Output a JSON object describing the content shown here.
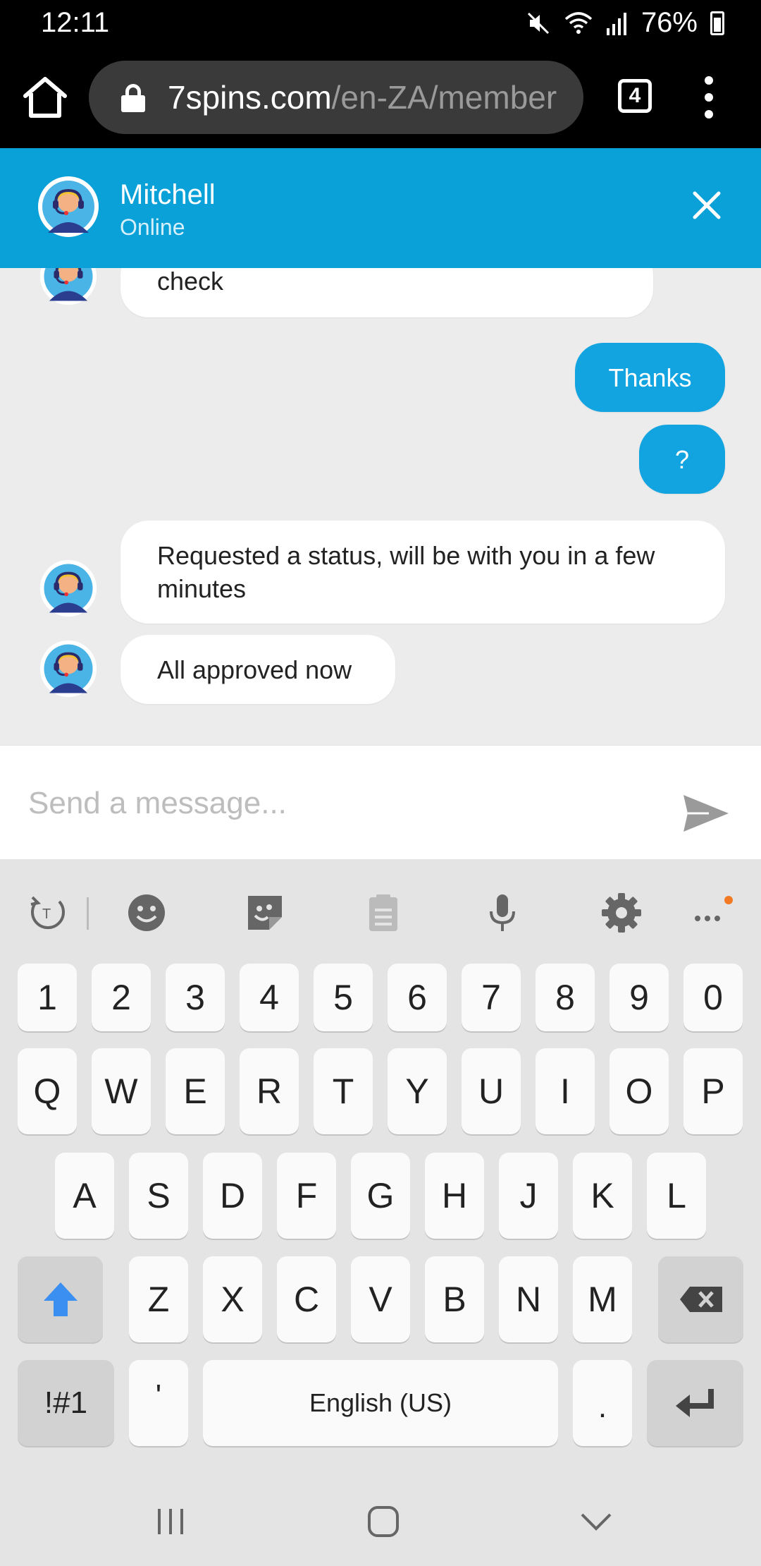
{
  "status_bar": {
    "time": "12:11",
    "battery": "76%"
  },
  "browser": {
    "url_host": "7spins.com",
    "url_path": "/en-ZA/member",
    "tab_count": "4"
  },
  "chat_header": {
    "agent_name": "Mitchell",
    "agent_status": "Online"
  },
  "messages": [
    {
      "from": "agent",
      "text": "Please allow me a few moments to check"
    },
    {
      "from": "user",
      "text": "Thanks"
    },
    {
      "from": "user",
      "text": "?"
    },
    {
      "from": "agent",
      "text": "Requested a status, will be with you in a few minutes"
    },
    {
      "from": "agent",
      "text": "All approved now"
    }
  ],
  "input": {
    "placeholder": "Send a message..."
  },
  "keyboard": {
    "numbers": [
      "1",
      "2",
      "3",
      "4",
      "5",
      "6",
      "7",
      "8",
      "9",
      "0"
    ],
    "row1": [
      "Q",
      "W",
      "E",
      "R",
      "T",
      "Y",
      "U",
      "I",
      "O",
      "P"
    ],
    "row2": [
      "A",
      "S",
      "D",
      "F",
      "G",
      "H",
      "J",
      "K",
      "L"
    ],
    "row3": [
      "Z",
      "X",
      "C",
      "V",
      "B",
      "N",
      "M"
    ],
    "symbols_key": "!#1",
    "apostrophe_key": "'",
    "space_label": "English (US)",
    "period_key": "."
  },
  "colors": {
    "header_blue": "#0aa0d8",
    "user_bubble": "#12a4e0",
    "shift_blue": "#3a8ff0",
    "notification_dot": "#f27a25"
  }
}
